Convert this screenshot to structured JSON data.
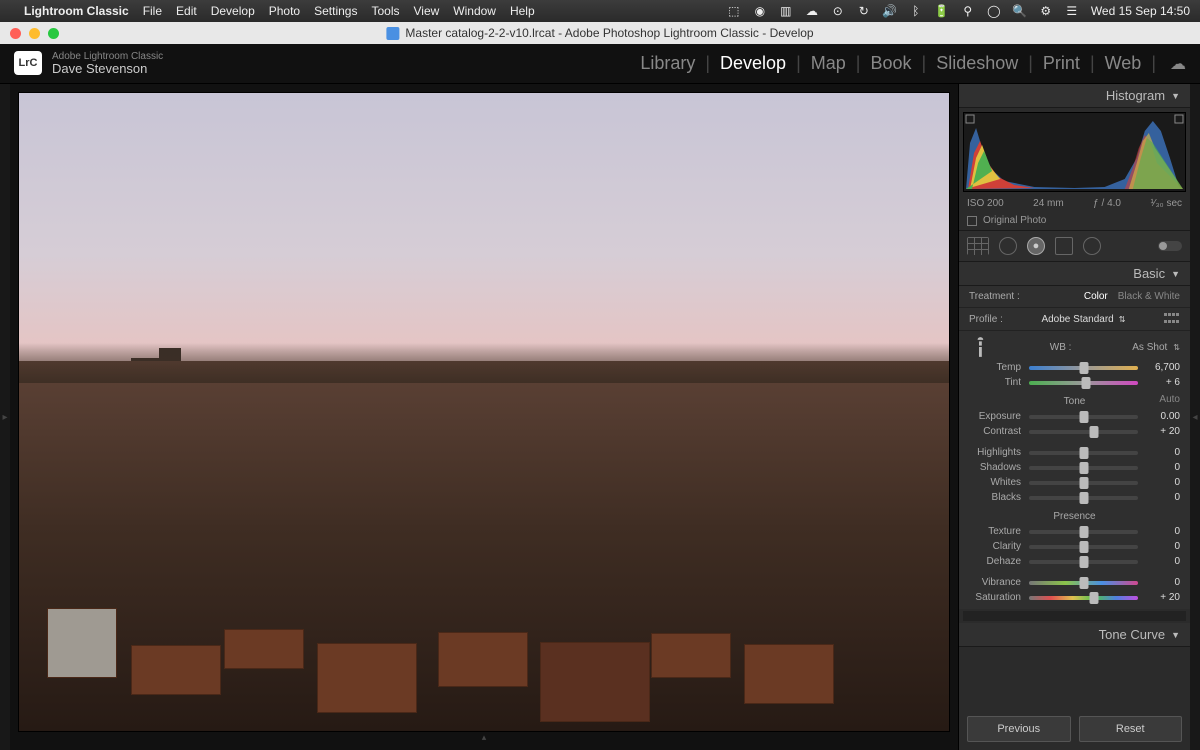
{
  "menubar": {
    "apple": "",
    "app": "Lightroom Classic",
    "items": [
      "File",
      "Edit",
      "Develop",
      "Photo",
      "Settings",
      "Tools",
      "View",
      "Window",
      "Help"
    ],
    "clock": "Wed 15 Sep  14:50"
  },
  "window": {
    "title": "Master catalog-2-2-v10.lrcat - Adobe Photoshop Lightroom Classic - Develop"
  },
  "header": {
    "badge": "LrC",
    "subtitle": "Adobe Lightroom Classic",
    "username": "Dave Stevenson",
    "modules": [
      "Library",
      "Develop",
      "Map",
      "Book",
      "Slideshow",
      "Print",
      "Web"
    ],
    "active_module": "Develop"
  },
  "histogram": {
    "title": "Histogram",
    "exif": {
      "iso": "ISO 200",
      "focal": "24 mm",
      "aperture": "ƒ / 4.0",
      "shutter": "¹⁄₃₀ sec"
    },
    "original_label": "Original Photo"
  },
  "basic": {
    "title": "Basic",
    "treatment_label": "Treatment :",
    "treatment_color": "Color",
    "treatment_bw": "Black & White",
    "profile_label": "Profile :",
    "profile_value": "Adobe Standard",
    "wb_label": "WB :",
    "wb_value": "As Shot",
    "temp_label": "Temp",
    "temp_value": "6,700",
    "tint_label": "Tint",
    "tint_value": "+ 6",
    "tone_label": "Tone",
    "auto_label": "Auto",
    "exposure_label": "Exposure",
    "exposure_value": "0.00",
    "contrast_label": "Contrast",
    "contrast_value": "+ 20",
    "highlights_label": "Highlights",
    "highlights_value": "0",
    "shadows_label": "Shadows",
    "shadows_value": "0",
    "whites_label": "Whites",
    "whites_value": "0",
    "blacks_label": "Blacks",
    "blacks_value": "0",
    "presence_label": "Presence",
    "texture_label": "Texture",
    "texture_value": "0",
    "clarity_label": "Clarity",
    "clarity_value": "0",
    "dehaze_label": "Dehaze",
    "dehaze_value": "0",
    "vibrance_label": "Vibrance",
    "vibrance_value": "0",
    "saturation_label": "Saturation",
    "saturation_value": "+ 20"
  },
  "tone_curve": {
    "title": "Tone Curve"
  },
  "buttons": {
    "previous": "Previous",
    "reset": "Reset"
  }
}
